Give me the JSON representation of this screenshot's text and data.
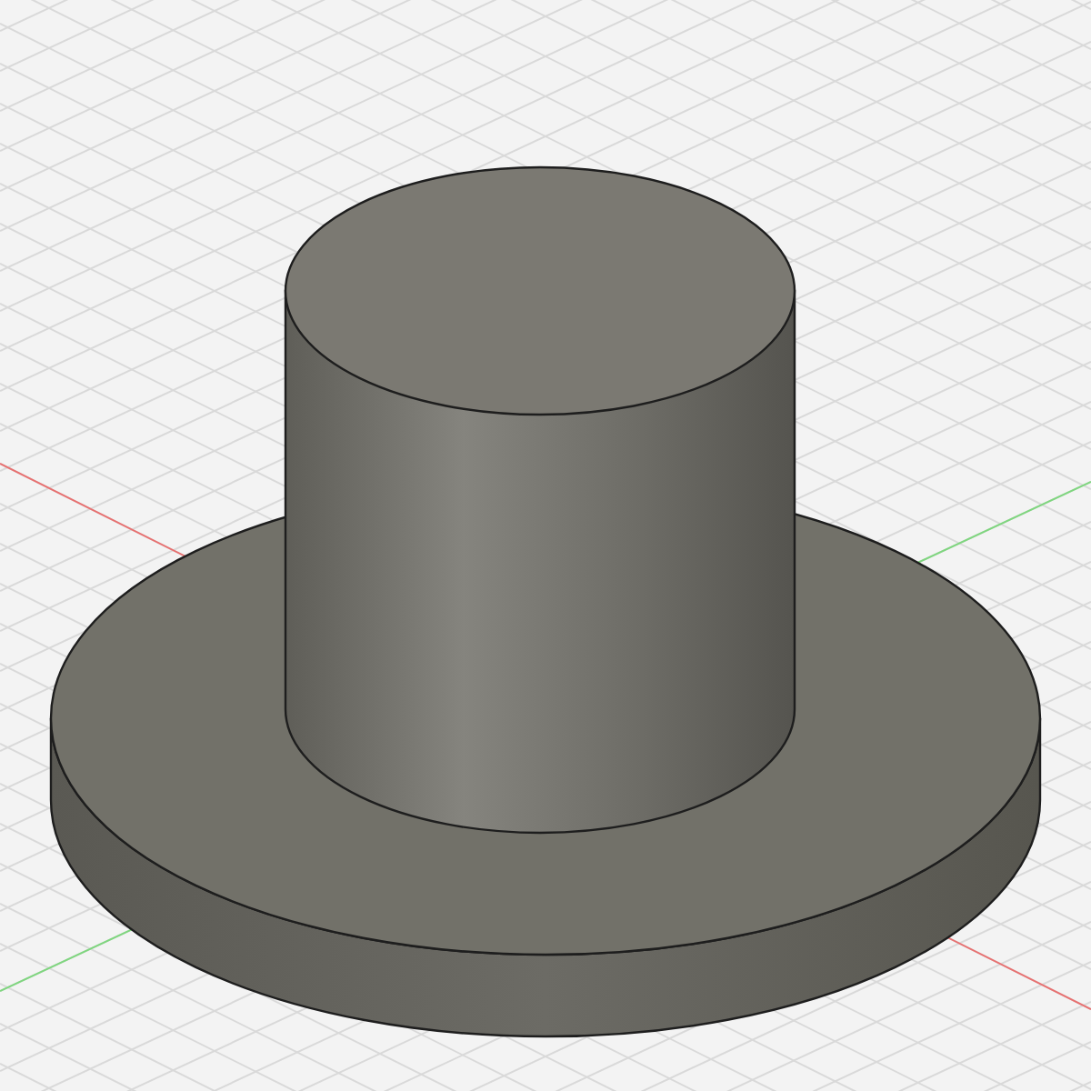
{
  "axes": [
    {
      "color": "#e87070"
    },
    {
      "color": "#7fd67f"
    }
  ]
}
